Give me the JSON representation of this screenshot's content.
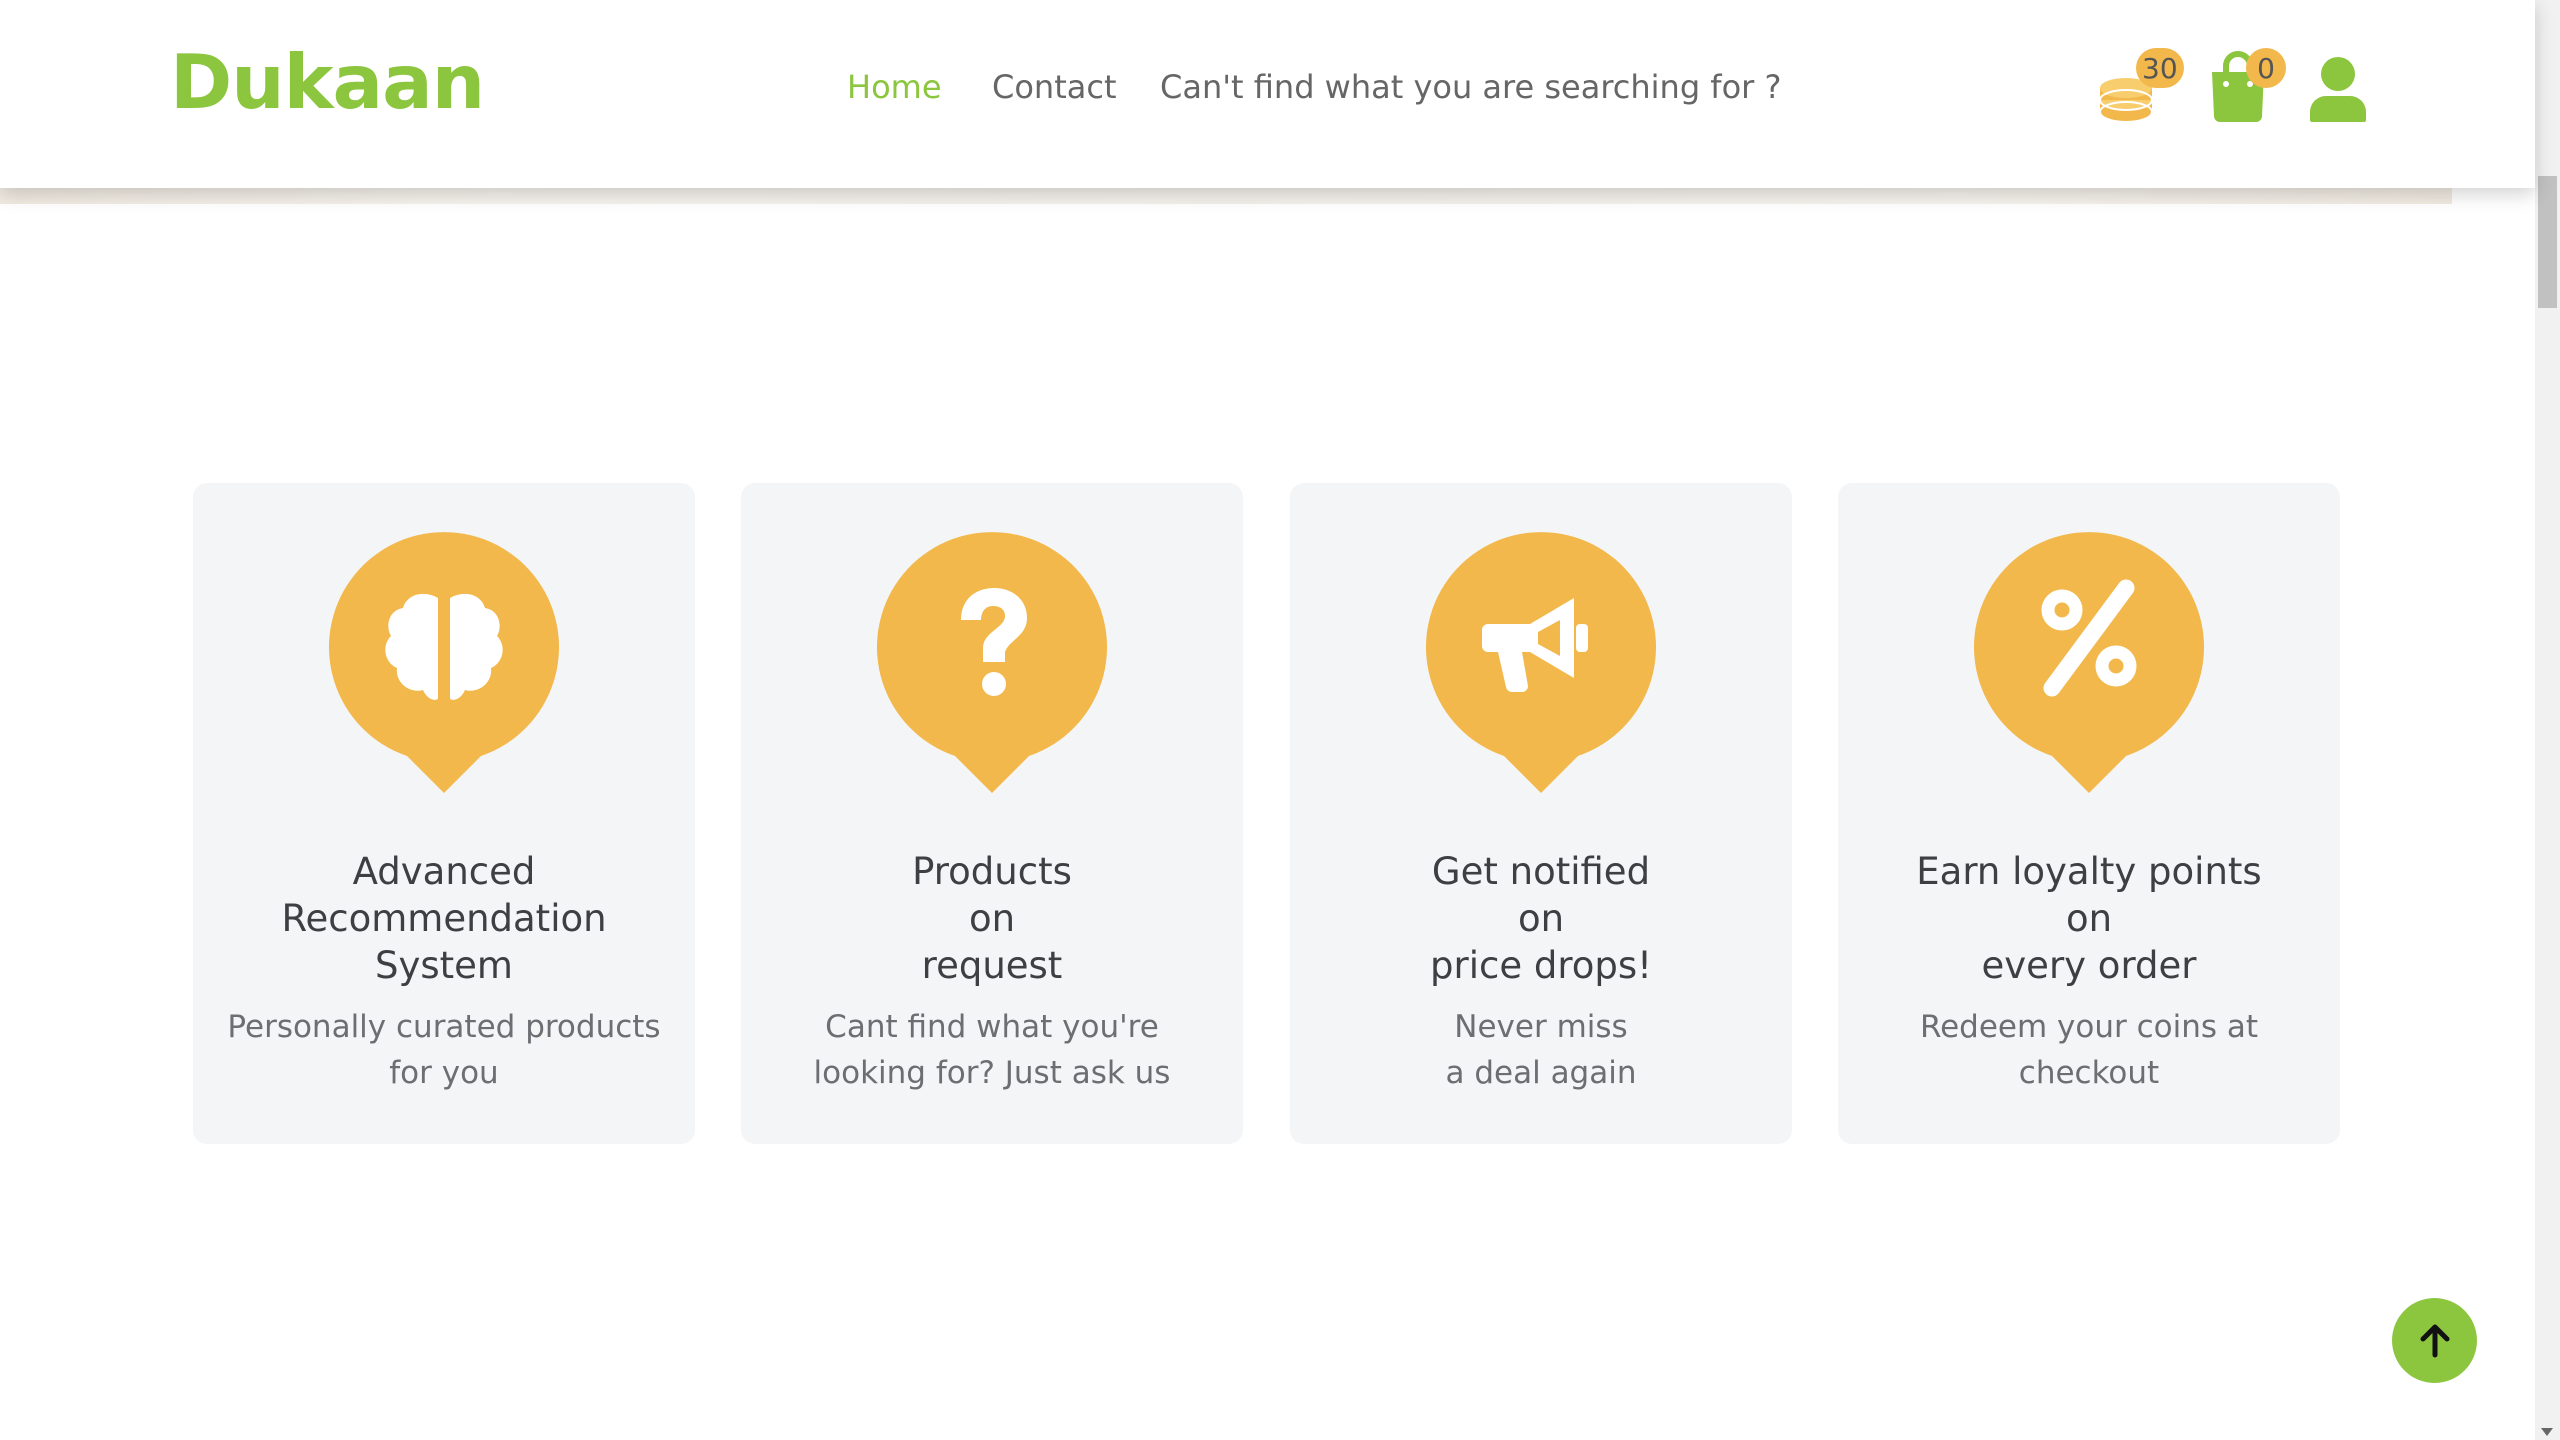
{
  "brand": {
    "name": "Dukaan",
    "color": "#8cc63f"
  },
  "nav": {
    "home": "Home",
    "contact": "Contact",
    "request": "Can't find what you are searching for ?"
  },
  "header_icons": {
    "coins": {
      "icon": "coins-icon",
      "count": "30"
    },
    "cart": {
      "icon": "shopping-bag-icon",
      "count": "0"
    },
    "user": {
      "icon": "user-icon"
    }
  },
  "features": [
    {
      "icon": "brain-icon",
      "title": "Advanced\nRecommendation\nSystem",
      "description": "Personally curated products\nfor you"
    },
    {
      "icon": "question-icon",
      "title": "Products\non\nrequest",
      "description": "Cant find what you're\nlooking for? Just ask us"
    },
    {
      "icon": "megaphone-icon",
      "title": "Get notified\non\nprice drops!",
      "description": "Never miss\na deal again"
    },
    {
      "icon": "percent-icon",
      "title": "Earn loyalty points\non\nevery order",
      "description": "Redeem your coins at\ncheckout"
    }
  ],
  "scroll_to_top": {
    "icon": "arrow-up-icon"
  },
  "colors": {
    "accent": "#8cc63f",
    "pin": "#f2b84b",
    "card_bg": "#f4f5f6"
  }
}
